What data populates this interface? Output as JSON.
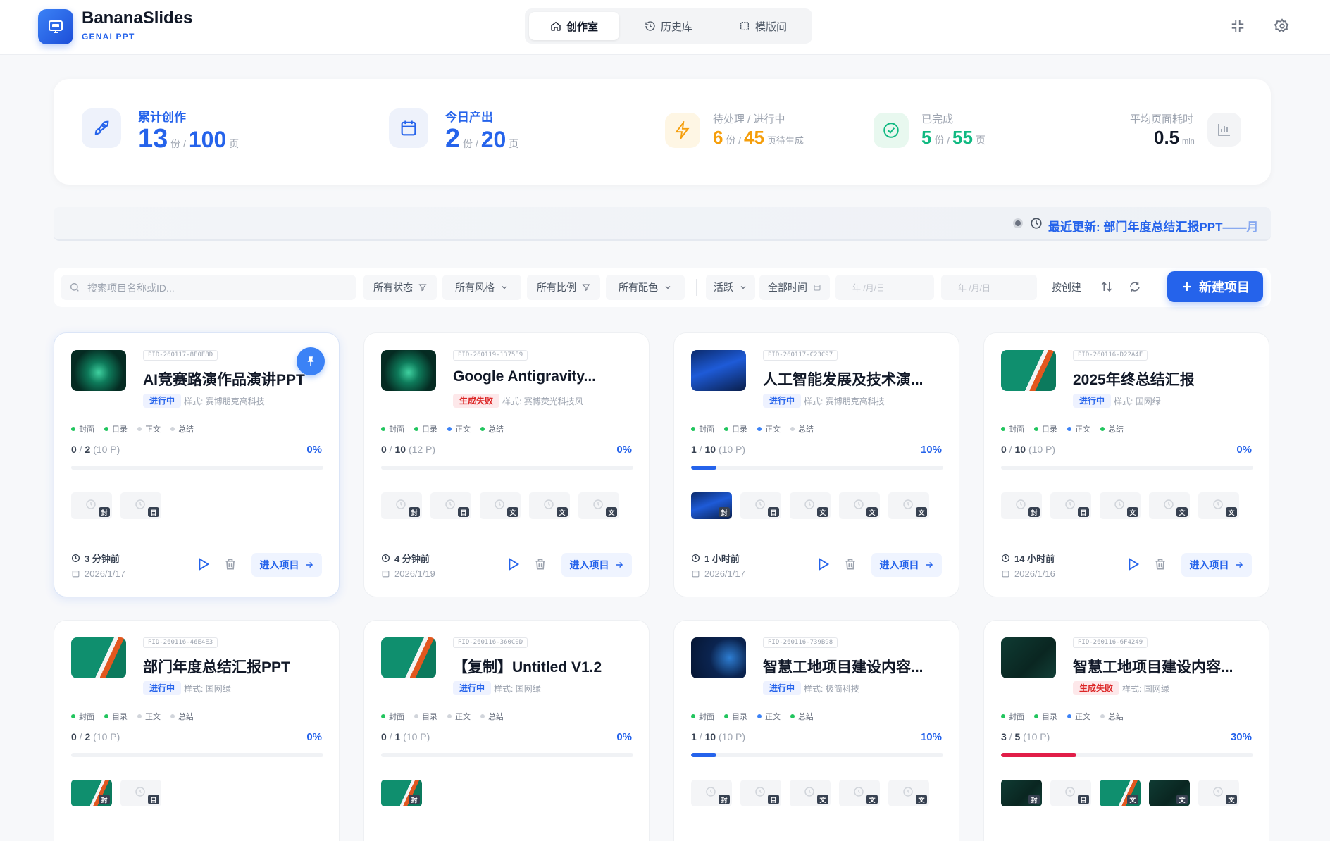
{
  "app": {
    "name": "BananaSlides",
    "subtitle": "GENAI PPT"
  },
  "nav": [
    {
      "label": "创作室",
      "icon": "home-icon",
      "active": true
    },
    {
      "label": "历史库",
      "icon": "history-icon",
      "active": false
    },
    {
      "label": "模版间",
      "icon": "template-icon",
      "active": false
    }
  ],
  "stats": {
    "total": {
      "label": "累计创作",
      "count": "13",
      "count_unit": "份 /",
      "pages": "100",
      "pages_unit": "页"
    },
    "today": {
      "label": "今日产出",
      "count": "2",
      "count_unit": "份 /",
      "pages": "20",
      "pages_unit": "页"
    },
    "pending": {
      "label": "待处理 / 进行中",
      "count": "6",
      "count_unit": "份 /",
      "pages": "45",
      "pages_unit": "页待生成"
    },
    "done": {
      "label": "已完成",
      "count": "5",
      "count_unit": "份 /",
      "pages": "55",
      "pages_unit": "页"
    },
    "avg": {
      "label": "平均页面耗时",
      "value": "0.5",
      "unit": "min"
    }
  },
  "ticker": {
    "prefix": "最近更新:",
    "text": "部门年度总结汇报PPT——",
    "tail": "月"
  },
  "filters": {
    "search_placeholder": "搜索项目名称或ID...",
    "status": "所有状态",
    "style": "所有风格",
    "ratio": "所有比例",
    "color": "所有配色",
    "activity": "活跃",
    "time": "全部时间",
    "date_from": "年 /月/日",
    "date_to": "年 /月/日",
    "sort": "按创建"
  },
  "new_button": "新建项目",
  "step_labels": [
    "封面",
    "目录",
    "正文",
    "总结"
  ],
  "style_prefix": "样式:",
  "enter_label": "进入项目",
  "colors": {
    "accent": "#2563eb",
    "step_done": "#22c55e",
    "step_active": "#3b82f6",
    "step_idle": "#d1d5db",
    "fail_bar": "#e11d48"
  },
  "projects": [
    {
      "pid": "PID-260117-8E0E8D",
      "title": "AI竞赛路演作品演讲PPT",
      "status": "进行中",
      "status_type": "run",
      "style": "赛博朋克高科技",
      "steps": [
        "done",
        "done",
        "idle",
        "idle"
      ],
      "done": "0",
      "total": "2",
      "pages": "(10 P)",
      "progress": 0,
      "pct": "0%",
      "slides": [
        {
          "t": "封",
          "img": false
        },
        {
          "t": "目",
          "img": false
        }
      ],
      "ago": "3 分钟前",
      "date": "2026/1/17",
      "pinned": true,
      "thumb": "cyber"
    },
    {
      "pid": "PID-260119-1375E9",
      "title": "Google Antigravity...",
      "status": "生成失败",
      "status_type": "fail",
      "style": "赛博荧光科技风",
      "steps": [
        "done",
        "done",
        "active",
        "done"
      ],
      "done": "0",
      "total": "10",
      "pages": "(12 P)",
      "progress": 0,
      "pct": "0%",
      "slides": [
        {
          "t": "封",
          "img": false
        },
        {
          "t": "目",
          "img": false
        },
        {
          "t": "文",
          "img": false
        },
        {
          "t": "文",
          "img": false
        },
        {
          "t": "文",
          "img": false
        }
      ],
      "ago": "4 分钟前",
      "date": "2026/1/19",
      "pinned": false,
      "thumb": "cyber"
    },
    {
      "pid": "PID-260117-C23C97",
      "title": "人工智能发展及技术演...",
      "status": "进行中",
      "status_type": "run",
      "style": "赛博朋克高科技",
      "steps": [
        "done",
        "done",
        "active",
        "idle"
      ],
      "done": "1",
      "total": "10",
      "pages": "(10 P)",
      "progress": 0.1,
      "pct": "10%",
      "slides": [
        {
          "t": "封",
          "img": true,
          "k": "blue"
        },
        {
          "t": "目",
          "img": false
        },
        {
          "t": "文",
          "img": false
        },
        {
          "t": "文",
          "img": false
        },
        {
          "t": "文",
          "img": false
        }
      ],
      "ago": "1 小时前",
      "date": "2026/1/17",
      "pinned": false,
      "thumb": "blue"
    },
    {
      "pid": "PID-260116-D22A4F",
      "title": "2025年终总结汇报",
      "status": "进行中",
      "status_type": "run",
      "style": "国网绿",
      "steps": [
        "done",
        "done",
        "active",
        "done"
      ],
      "done": "0",
      "total": "10",
      "pages": "(10 P)",
      "progress": 0,
      "pct": "0%",
      "slides": [
        {
          "t": "封",
          "img": false
        },
        {
          "t": "目",
          "img": false
        },
        {
          "t": "文",
          "img": false
        },
        {
          "t": "文",
          "img": false
        },
        {
          "t": "文",
          "img": false
        }
      ],
      "ago": "14 小时前",
      "date": "2026/1/16",
      "pinned": false,
      "thumb": "green"
    },
    {
      "pid": "PID-260116-46E4E3",
      "title": "部门年度总结汇报PPT",
      "status": "进行中",
      "status_type": "run",
      "style": "国网绿",
      "steps": [
        "done",
        "done",
        "idle",
        "idle"
      ],
      "done": "0",
      "total": "2",
      "pages": "(10 P)",
      "progress": 0,
      "pct": "0%",
      "slides": [
        {
          "t": "封",
          "img": true,
          "k": "green"
        },
        {
          "t": "目",
          "img": false
        }
      ],
      "pinned": false,
      "thumb": "green"
    },
    {
      "pid": "PID-260116-360C0D",
      "title": "【复制】Untitled V1.2",
      "status": "进行中",
      "status_type": "run",
      "style": "国网绿",
      "steps": [
        "done",
        "idle",
        "idle",
        "idle"
      ],
      "done": "0",
      "total": "1",
      "pages": "(10 P)",
      "progress": 0,
      "pct": "0%",
      "slides": [
        {
          "t": "封",
          "img": true,
          "k": "green"
        }
      ],
      "pinned": false,
      "thumb": "green"
    },
    {
      "pid": "PID-260116-739B98",
      "title": "智慧工地项目建设内容...",
      "status": "进行中",
      "status_type": "run",
      "style": "极简科技",
      "steps": [
        "done",
        "done",
        "active",
        "done"
      ],
      "done": "1",
      "total": "10",
      "pages": "(10 P)",
      "progress": 0.1,
      "pct": "10%",
      "slides": [
        {
          "t": "封",
          "img": false
        },
        {
          "t": "目",
          "img": false
        },
        {
          "t": "文",
          "img": false
        },
        {
          "t": "文",
          "img": false
        },
        {
          "t": "文",
          "img": false
        }
      ],
      "pinned": false,
      "thumb": "circuit"
    },
    {
      "pid": "PID-260116-6F4249",
      "title": "智慧工地项目建设内容...",
      "status": "生成失败",
      "status_type": "fail",
      "style": "国网绿",
      "steps": [
        "done",
        "done",
        "active",
        "idle"
      ],
      "done": "3",
      "total": "5",
      "pages": "(10 P)",
      "progress": 0.3,
      "pct": "30%",
      "slides": [
        {
          "t": "封",
          "img": true,
          "k": "dark"
        },
        {
          "t": "目",
          "img": false
        },
        {
          "t": "文",
          "img": true,
          "k": "green"
        },
        {
          "t": "文",
          "img": true,
          "k": "dark"
        },
        {
          "t": "文",
          "img": false
        }
      ],
      "pinned": false,
      "thumb": "dark"
    }
  ]
}
